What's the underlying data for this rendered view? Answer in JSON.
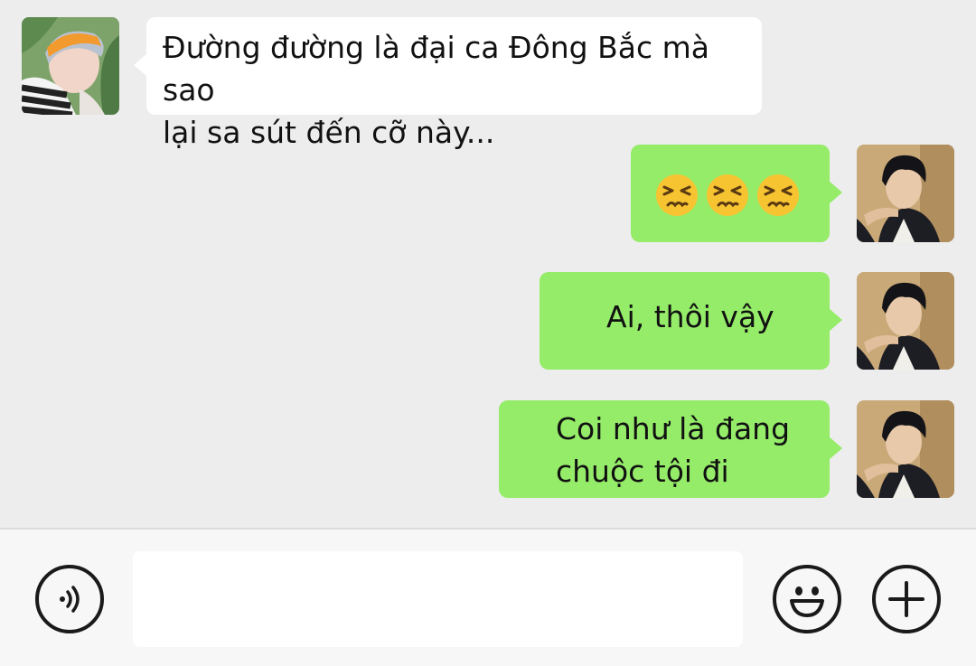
{
  "messages": [
    {
      "side": "left",
      "lines": [
        "Đường đường là đại ca Đông Bắc mà sao",
        "lại sa sút đến cỡ này..."
      ]
    },
    {
      "side": "right",
      "emoji": [
        "persevering-face",
        "persevering-face",
        "persevering-face"
      ]
    },
    {
      "side": "right",
      "lines": [
        "Ai, thôi vậy"
      ]
    },
    {
      "side": "right",
      "lines": [
        "Coi như là đang",
        "chuộc tội đi"
      ]
    }
  ],
  "input_bar": {
    "text_value": "",
    "left_icon": "voice-icon",
    "right_icons": [
      "emoji-icon",
      "plus-icon"
    ]
  },
  "colors": {
    "background": "#ededed",
    "sent_bubble": "#95ec69",
    "received_bubble": "#ffffff",
    "input_bar": "#f7f7f7"
  }
}
